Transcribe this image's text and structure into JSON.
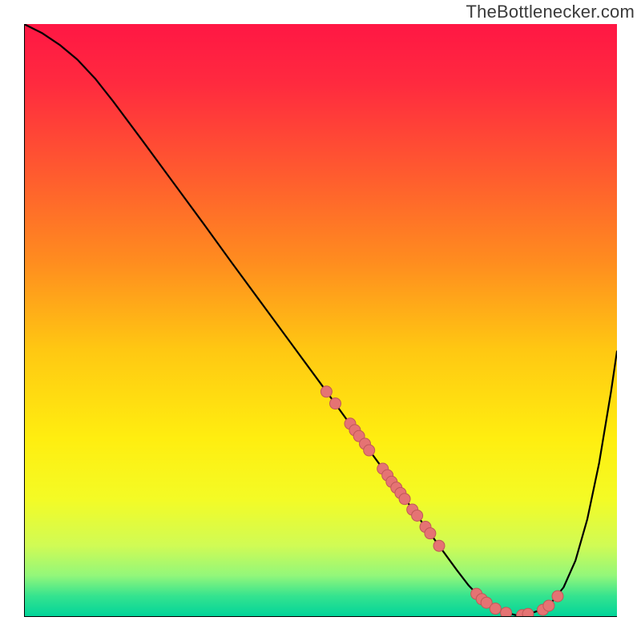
{
  "watermark": "TheBottlenecker.com",
  "chart_data": {
    "type": "line",
    "title": "",
    "xlabel": "",
    "ylabel": "",
    "xlim": [
      0,
      100
    ],
    "ylim": [
      0,
      100
    ],
    "gradient_stops": [
      {
        "offset": 0.0,
        "color": "#ff1744"
      },
      {
        "offset": 0.1,
        "color": "#ff2a3f"
      },
      {
        "offset": 0.25,
        "color": "#ff5a2f"
      },
      {
        "offset": 0.4,
        "color": "#ff8c1f"
      },
      {
        "offset": 0.55,
        "color": "#ffc812"
      },
      {
        "offset": 0.7,
        "color": "#ffee10"
      },
      {
        "offset": 0.8,
        "color": "#f4fb25"
      },
      {
        "offset": 0.88,
        "color": "#d0fb55"
      },
      {
        "offset": 0.93,
        "color": "#93f77a"
      },
      {
        "offset": 0.965,
        "color": "#34e38f"
      },
      {
        "offset": 1.0,
        "color": "#00d49a"
      }
    ],
    "curve": [
      {
        "x": 0.0,
        "y": 100.0
      },
      {
        "x": 3.0,
        "y": 98.5
      },
      {
        "x": 6.0,
        "y": 96.5
      },
      {
        "x": 9.0,
        "y": 94.0
      },
      {
        "x": 12.0,
        "y": 90.8
      },
      {
        "x": 15.0,
        "y": 87.0
      },
      {
        "x": 20.0,
        "y": 80.3
      },
      {
        "x": 25.0,
        "y": 73.5
      },
      {
        "x": 30.0,
        "y": 66.7
      },
      {
        "x": 35.0,
        "y": 59.8
      },
      {
        "x": 40.0,
        "y": 53.0
      },
      {
        "x": 45.0,
        "y": 46.2
      },
      {
        "x": 50.0,
        "y": 39.4
      },
      {
        "x": 55.0,
        "y": 32.5
      },
      {
        "x": 60.0,
        "y": 25.7
      },
      {
        "x": 65.0,
        "y": 18.9
      },
      {
        "x": 70.0,
        "y": 12.0
      },
      {
        "x": 73.0,
        "y": 7.9
      },
      {
        "x": 75.0,
        "y": 5.3
      },
      {
        "x": 77.0,
        "y": 3.2
      },
      {
        "x": 79.0,
        "y": 1.7
      },
      {
        "x": 81.0,
        "y": 0.8
      },
      {
        "x": 83.0,
        "y": 0.3
      },
      {
        "x": 85.0,
        "y": 0.5
      },
      {
        "x": 87.0,
        "y": 1.1
      },
      {
        "x": 89.0,
        "y": 2.5
      },
      {
        "x": 91.0,
        "y": 5.0
      },
      {
        "x": 93.0,
        "y": 9.5
      },
      {
        "x": 95.0,
        "y": 16.5
      },
      {
        "x": 97.0,
        "y": 26.0
      },
      {
        "x": 99.0,
        "y": 38.0
      },
      {
        "x": 100.0,
        "y": 44.8
      }
    ],
    "points": [
      {
        "x": 51.0,
        "y": 38.0
      },
      {
        "x": 52.5,
        "y": 36.0
      },
      {
        "x": 55.0,
        "y": 32.6
      },
      {
        "x": 55.8,
        "y": 31.5
      },
      {
        "x": 56.5,
        "y": 30.5
      },
      {
        "x": 57.5,
        "y": 29.2
      },
      {
        "x": 58.2,
        "y": 28.1
      },
      {
        "x": 60.5,
        "y": 25.0
      },
      {
        "x": 61.3,
        "y": 23.9
      },
      {
        "x": 62.0,
        "y": 22.8
      },
      {
        "x": 62.8,
        "y": 21.8
      },
      {
        "x": 63.5,
        "y": 20.9
      },
      {
        "x": 64.2,
        "y": 19.9
      },
      {
        "x": 65.5,
        "y": 18.1
      },
      {
        "x": 66.3,
        "y": 17.1
      },
      {
        "x": 67.7,
        "y": 15.2
      },
      {
        "x": 68.5,
        "y": 14.1
      },
      {
        "x": 70.0,
        "y": 12.0
      },
      {
        "x": 76.3,
        "y": 3.9
      },
      {
        "x": 77.2,
        "y": 3.0
      },
      {
        "x": 78.0,
        "y": 2.4
      },
      {
        "x": 79.5,
        "y": 1.4
      },
      {
        "x": 81.3,
        "y": 0.7
      },
      {
        "x": 84.0,
        "y": 0.3
      },
      {
        "x": 85.0,
        "y": 0.5
      },
      {
        "x": 87.5,
        "y": 1.2
      },
      {
        "x": 88.5,
        "y": 1.9
      },
      {
        "x": 90.0,
        "y": 3.5
      }
    ],
    "point_color": "#e57373",
    "point_stroke": "#c05858",
    "line_color": "#000000"
  }
}
